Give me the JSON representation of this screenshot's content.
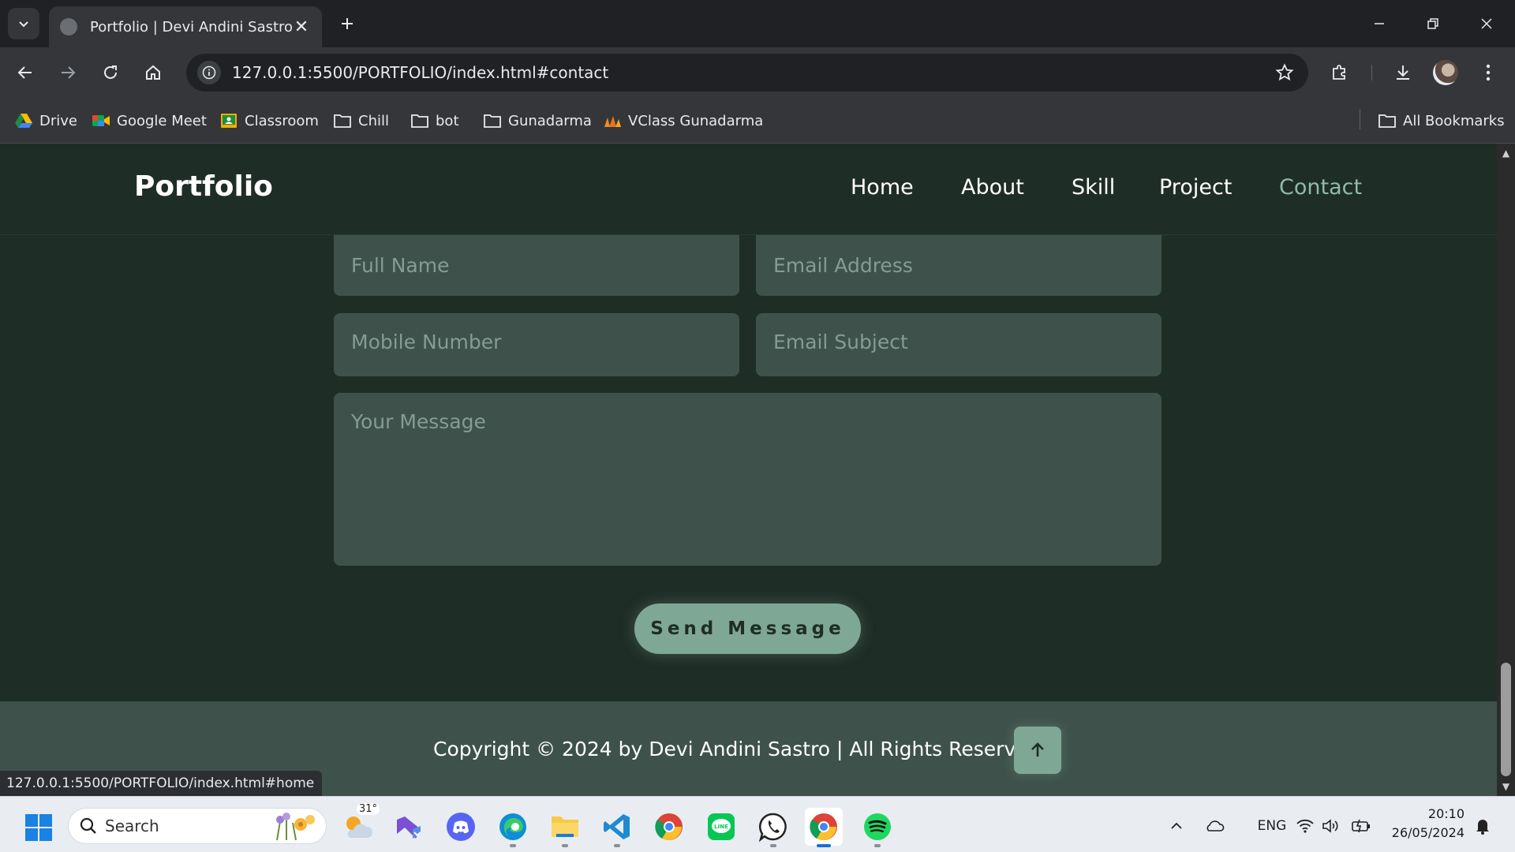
{
  "browser": {
    "tab_title": "Portfolio | Devi Andini Sastro",
    "url": "127.0.0.1:5500/PORTFOLIO/index.html#contact",
    "status_url": "127.0.0.1:5500/PORTFOLIO/index.html#home",
    "bookmarks": [
      "Drive",
      "Google Meet",
      "Classroom",
      "Chill",
      "bot",
      "Gunadarma",
      "VClass Gunadarma"
    ],
    "all_bookmarks": "All Bookmarks"
  },
  "page": {
    "logo": "Portfolio",
    "nav": [
      "Home",
      "About",
      "Skill",
      "Project",
      "Contact"
    ],
    "active_nav": "Contact",
    "form": {
      "full_name_placeholder": "Full Name",
      "email_placeholder": "Email Address",
      "mobile_placeholder": "Mobile Number",
      "subject_placeholder": "Email Subject",
      "message_placeholder": "Your Message",
      "submit_label": "Send Message"
    },
    "footer": {
      "copyright": "Copyright © 2024 by Devi Andini Sastro | All Rights Reserved."
    },
    "colors": {
      "background": "#1f2d27",
      "input": "#3e524b",
      "accent": "#7fa796",
      "active_nav": "#8fbba8"
    }
  },
  "taskbar": {
    "search_label": "Search",
    "weather_temp": "31°",
    "language": "ENG",
    "time": "20:10",
    "date": "26/05/2024",
    "apps": [
      "weather-icon",
      "visual-studio-icon",
      "discord-icon",
      "edge-icon",
      "file-explorer-icon",
      "vscode-icon",
      "chrome-icon",
      "line-icon",
      "whatsapp-icon",
      "chrome-icon",
      "spotify-icon"
    ]
  }
}
